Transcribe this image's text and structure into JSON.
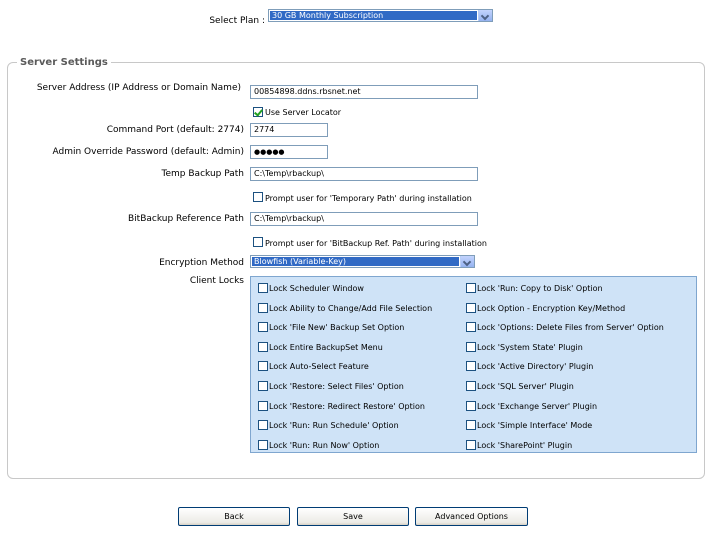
{
  "plan": {
    "label": "Select Plan :",
    "selected": "30 GB Monthly Subscription"
  },
  "server_settings": {
    "legend": "Server Settings",
    "server_address": {
      "label": "Server Address (IP Address or Domain Name)",
      "value": "00854898.ddns.rbsnet.net"
    },
    "use_server_locator": {
      "label": "Use Server Locator",
      "checked": true
    },
    "command_port": {
      "label": "Command Port (default: 2774)",
      "value": "2774"
    },
    "admin_password": {
      "label": "Admin Override Password (default: Admin)",
      "value": "●●●●●"
    },
    "temp_backup_path": {
      "label": "Temp Backup Path",
      "value": "C:\\Temp\\rbackup\\"
    },
    "prompt_temp": {
      "label": "Prompt user for 'Temporary Path' during installation",
      "checked": false
    },
    "bitbackup_path": {
      "label": "BitBackup Reference Path",
      "value": "C:\\Temp\\rbackup\\"
    },
    "prompt_bitbackup": {
      "label": "Prompt user for 'BitBackup Ref. Path' during installation",
      "checked": false
    },
    "encryption": {
      "label": "Encryption Method",
      "selected": "Blowfish (Variable-Key)"
    },
    "client_locks": {
      "label": "Client Locks",
      "left": [
        "Lock Scheduler Window",
        "Lock Ability to Change/Add File Selection",
        "Lock 'File New' Backup Set Option",
        "Lock Entire BackupSet Menu",
        "Lock Auto-Select Feature",
        "Lock 'Restore: Select Files' Option",
        "Lock 'Restore: Redirect Restore' Option",
        "Lock 'Run: Run Schedule' Option",
        "Lock 'Run: Run Now' Option"
      ],
      "right": [
        "Lock 'Run: Copy to Disk' Option",
        "Lock Option - Encryption Key/Method",
        "Lock 'Options: Delete Files from Server' Option",
        "Lock 'System State' Plugin",
        "Lock 'Active Directory' Plugin",
        "Lock 'SQL Server' Plugin",
        "Lock 'Exchange Server' Plugin",
        "Lock 'Simple Interface' Mode",
        "Lock 'SharePoint' Plugin"
      ]
    }
  },
  "buttons": {
    "back": "Back",
    "save": "Save",
    "advanced": "Advanced Options"
  }
}
